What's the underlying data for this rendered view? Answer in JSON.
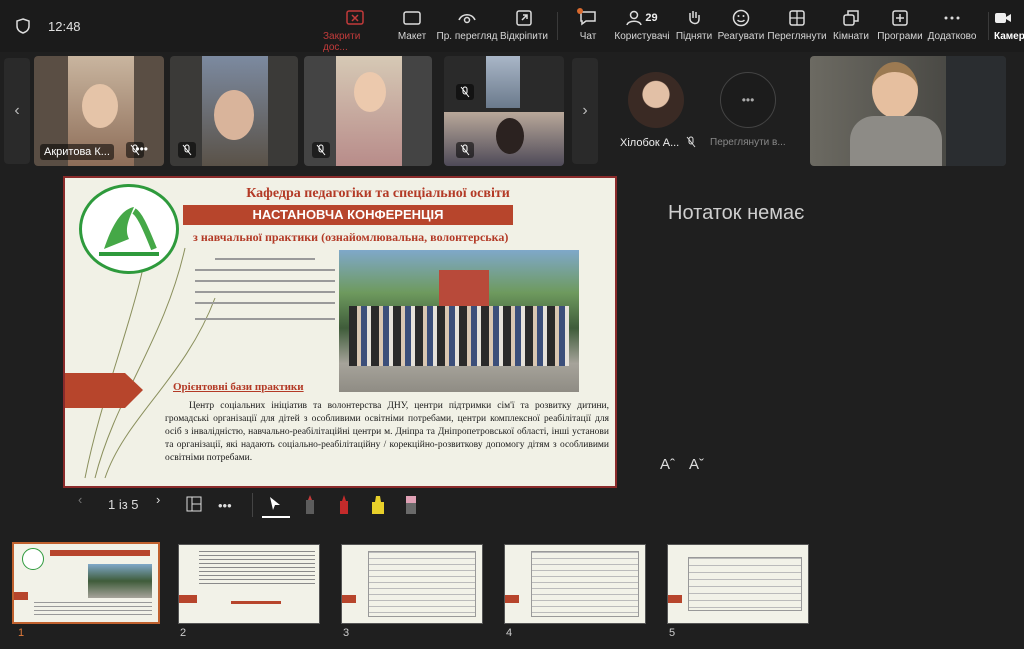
{
  "topbar": {
    "time": "12:48",
    "buttons": [
      {
        "label": "Закрити дос...",
        "icon": "close-share-icon"
      },
      {
        "label": "Макет",
        "icon": "layout-icon"
      },
      {
        "label": "Пр. перегляд",
        "icon": "preview-icon"
      },
      {
        "label": "Відкріпити",
        "icon": "popout-icon"
      },
      {
        "label": "Чат",
        "icon": "chat-icon"
      },
      {
        "label": "Користувачі",
        "icon": "people-icon",
        "count": "29"
      },
      {
        "label": "Підняти",
        "icon": "raise-hand-icon"
      },
      {
        "label": "Реагувати",
        "icon": "react-icon"
      },
      {
        "label": "Переглянути",
        "icon": "view-icon"
      },
      {
        "label": "Кімнати",
        "icon": "rooms-icon"
      },
      {
        "label": "Програми",
        "icon": "apps-icon"
      },
      {
        "label": "Додатково",
        "icon": "more-icon"
      },
      {
        "label": "Камера",
        "icon": "camera-icon"
      }
    ]
  },
  "participants": {
    "tile1_name": "Акритова К...",
    "named_avatar": "Хілобок А...",
    "view_more": "Переглянути в..."
  },
  "slide": {
    "title1": "Кафедра педагогіки та спеціальної освіти",
    "title2": "НАСТАНОВЧА КОНФЕРЕНЦІЯ",
    "title3": "з навчальної практики (ознайомлювальна, волонтерська)",
    "section": "Орієнтовні бази практики",
    "body": "Центр соціальних ініціатив та волонтерства ДНУ, центри підтримки сім'ї та розвитку дитини, громадські організації для дітей з особливими освітніми потребами, центри комплексної реабілітації для осіб з інвалідністю, навчально-реабілітаційні центри м. Дніпра та Дніпропетровської області, інші установи та організації, які надають соціально-реабілітаційну / корекційно-розвиткову допомогу дітям з особливими освітніми потребами."
  },
  "notes": {
    "empty_text": "Нотаток немає",
    "font_increase": "Aˆ",
    "font_decrease": "Aˇ"
  },
  "controls": {
    "page_indicator": "1 із 5"
  },
  "thumbnails": [
    {
      "num": "1"
    },
    {
      "num": "2"
    },
    {
      "num": "3"
    },
    {
      "num": "4"
    },
    {
      "num": "5"
    }
  ]
}
